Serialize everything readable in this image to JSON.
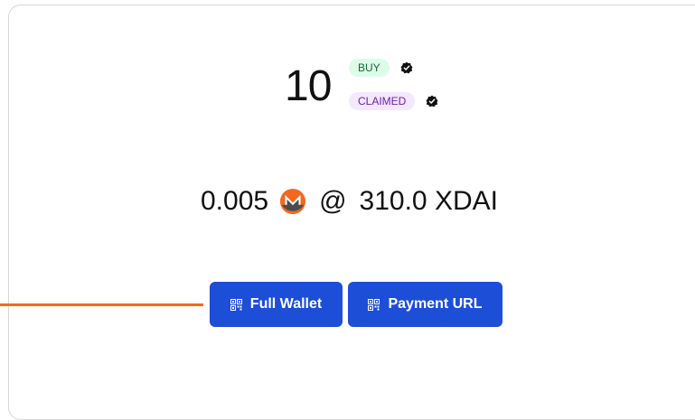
{
  "order": {
    "amount": "10",
    "type_badge": "BUY",
    "status_badge": "CLAIMED"
  },
  "price": {
    "quantity": "0.005",
    "coin_icon": "monero-icon",
    "at": "@",
    "rate": "310.0 XDAI"
  },
  "actions": {
    "full_wallet_label": "Full Wallet",
    "payment_url_label": "Payment URL",
    "icon": "qr-code-icon"
  },
  "colors": {
    "button": "#1d4ed8",
    "buy_badge_bg": "#dcfce7",
    "claimed_badge_bg": "#f3e8ff",
    "pointer": "#f26b1d",
    "monero_orange": "#f26822"
  }
}
